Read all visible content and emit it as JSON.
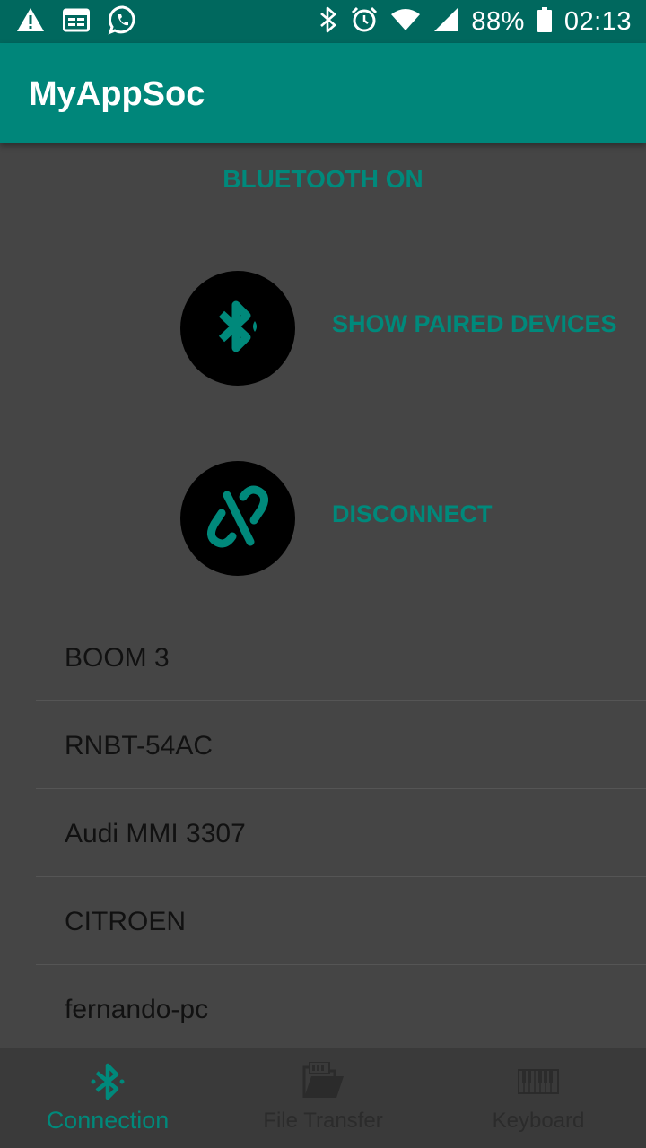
{
  "status_bar": {
    "battery": "88%",
    "time": "02:13",
    "icons_left": [
      "warning-icon",
      "calendar-icon",
      "whatsapp-icon"
    ],
    "icons_right": [
      "bluetooth-icon",
      "alarm-icon",
      "wifi-icon",
      "signal-icon",
      "battery-icon"
    ]
  },
  "app_bar": {
    "title": "MyAppSoc"
  },
  "bluetooth_status": "BLUETOOTH ON",
  "actions": {
    "show_paired": {
      "label": "SHOW PAIRED DEVICES",
      "icon": "bluetooth-searching-icon"
    },
    "disconnect": {
      "label": "DISCONNECT",
      "icon": "link-off-icon"
    }
  },
  "devices": [
    "BOOM 3",
    "RNBT-54AC",
    "Audi MMI 3307",
    "CITROEN",
    "fernando-pc"
  ],
  "bottom_nav": {
    "items": [
      {
        "label": "Connection",
        "icon": "bluetooth-icon",
        "active": true
      },
      {
        "label": "File Transfer",
        "icon": "midi-folder-icon",
        "active": false
      },
      {
        "label": "Keyboard",
        "icon": "piano-icon",
        "active": false
      }
    ]
  },
  "colors": {
    "status_bar": "#00685e",
    "app_bar": "#00867a",
    "accent": "#00897b",
    "background": "#454545"
  }
}
